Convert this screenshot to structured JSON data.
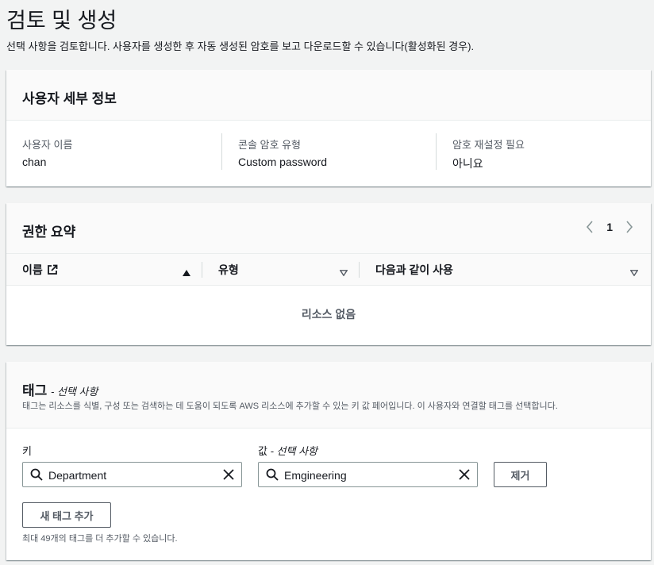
{
  "page": {
    "title": "검토 및 생성",
    "description": "선택 사항을 검토합니다. 사용자를 생성한 후 자동 생성된 암호를 보고 다운로드할 수 있습니다(활성화된 경우)."
  },
  "user_details": {
    "title": "사용자 세부 정보",
    "fields": [
      {
        "label": "사용자 이름",
        "value": "chan"
      },
      {
        "label": "콘솔 암호 유형",
        "value": "Custom password"
      },
      {
        "label": "암호 재설정 필요",
        "value": "아니요"
      }
    ]
  },
  "permissions": {
    "title": "권한 요약",
    "page_number": "1",
    "columns": [
      {
        "label": "이름",
        "icon": "external-link-icon",
        "sort": "sorted-ascending-icon"
      },
      {
        "label": "유형",
        "sort": "sort-icon"
      },
      {
        "label": "다음과 같이 사용",
        "sort": "sort-icon"
      }
    ],
    "empty_text": "리소스 없음"
  },
  "tags": {
    "title": "태그",
    "title_suffix": "- 선택 사항",
    "description": "태그는 리소스를 식별, 구성 또는 검색하는 데 도움이 되도록 AWS 리소스에 추가할 수 있는 키 값 페어입니다. 이 사용자와 연결할 태그를 선택합니다.",
    "key_label": "키",
    "value_label": "값",
    "value_label_suffix": "- 선택 사항",
    "key_value": "Department",
    "value_value": "Emgineering",
    "remove_label": "제거",
    "add_label": "새 태그 추가",
    "hint": "최대 49개의 태그를 더 추가할 수 있습니다."
  },
  "colors": {
    "background": "#f2f3f3",
    "text": "#16191f",
    "secondary_text": "#545b64",
    "border": "#879596"
  }
}
